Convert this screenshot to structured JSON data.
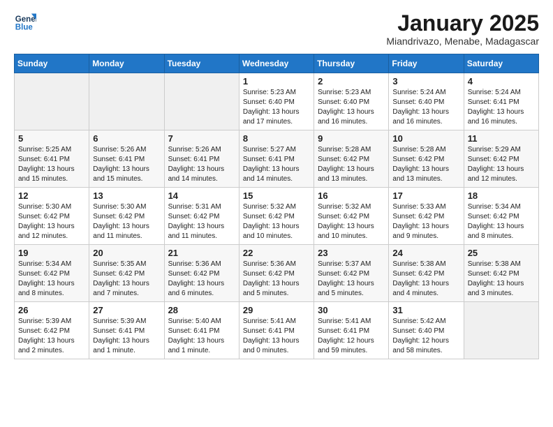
{
  "logo": {
    "line1": "General",
    "line2": "Blue"
  },
  "title": "January 2025",
  "subtitle": "Miandrivazo, Menabe, Madagascar",
  "weekdays": [
    "Sunday",
    "Monday",
    "Tuesday",
    "Wednesday",
    "Thursday",
    "Friday",
    "Saturday"
  ],
  "weeks": [
    [
      {
        "day": "",
        "content": ""
      },
      {
        "day": "",
        "content": ""
      },
      {
        "day": "",
        "content": ""
      },
      {
        "day": "1",
        "content": "Sunrise: 5:23 AM\nSunset: 6:40 PM\nDaylight: 13 hours\nand 17 minutes."
      },
      {
        "day": "2",
        "content": "Sunrise: 5:23 AM\nSunset: 6:40 PM\nDaylight: 13 hours\nand 16 minutes."
      },
      {
        "day": "3",
        "content": "Sunrise: 5:24 AM\nSunset: 6:40 PM\nDaylight: 13 hours\nand 16 minutes."
      },
      {
        "day": "4",
        "content": "Sunrise: 5:24 AM\nSunset: 6:41 PM\nDaylight: 13 hours\nand 16 minutes."
      }
    ],
    [
      {
        "day": "5",
        "content": "Sunrise: 5:25 AM\nSunset: 6:41 PM\nDaylight: 13 hours\nand 15 minutes."
      },
      {
        "day": "6",
        "content": "Sunrise: 5:26 AM\nSunset: 6:41 PM\nDaylight: 13 hours\nand 15 minutes."
      },
      {
        "day": "7",
        "content": "Sunrise: 5:26 AM\nSunset: 6:41 PM\nDaylight: 13 hours\nand 14 minutes."
      },
      {
        "day": "8",
        "content": "Sunrise: 5:27 AM\nSunset: 6:41 PM\nDaylight: 13 hours\nand 14 minutes."
      },
      {
        "day": "9",
        "content": "Sunrise: 5:28 AM\nSunset: 6:42 PM\nDaylight: 13 hours\nand 13 minutes."
      },
      {
        "day": "10",
        "content": "Sunrise: 5:28 AM\nSunset: 6:42 PM\nDaylight: 13 hours\nand 13 minutes."
      },
      {
        "day": "11",
        "content": "Sunrise: 5:29 AM\nSunset: 6:42 PM\nDaylight: 13 hours\nand 12 minutes."
      }
    ],
    [
      {
        "day": "12",
        "content": "Sunrise: 5:30 AM\nSunset: 6:42 PM\nDaylight: 13 hours\nand 12 minutes."
      },
      {
        "day": "13",
        "content": "Sunrise: 5:30 AM\nSunset: 6:42 PM\nDaylight: 13 hours\nand 11 minutes."
      },
      {
        "day": "14",
        "content": "Sunrise: 5:31 AM\nSunset: 6:42 PM\nDaylight: 13 hours\nand 11 minutes."
      },
      {
        "day": "15",
        "content": "Sunrise: 5:32 AM\nSunset: 6:42 PM\nDaylight: 13 hours\nand 10 minutes."
      },
      {
        "day": "16",
        "content": "Sunrise: 5:32 AM\nSunset: 6:42 PM\nDaylight: 13 hours\nand 10 minutes."
      },
      {
        "day": "17",
        "content": "Sunrise: 5:33 AM\nSunset: 6:42 PM\nDaylight: 13 hours\nand 9 minutes."
      },
      {
        "day": "18",
        "content": "Sunrise: 5:34 AM\nSunset: 6:42 PM\nDaylight: 13 hours\nand 8 minutes."
      }
    ],
    [
      {
        "day": "19",
        "content": "Sunrise: 5:34 AM\nSunset: 6:42 PM\nDaylight: 13 hours\nand 8 minutes."
      },
      {
        "day": "20",
        "content": "Sunrise: 5:35 AM\nSunset: 6:42 PM\nDaylight: 13 hours\nand 7 minutes."
      },
      {
        "day": "21",
        "content": "Sunrise: 5:36 AM\nSunset: 6:42 PM\nDaylight: 13 hours\nand 6 minutes."
      },
      {
        "day": "22",
        "content": "Sunrise: 5:36 AM\nSunset: 6:42 PM\nDaylight: 13 hours\nand 5 minutes."
      },
      {
        "day": "23",
        "content": "Sunrise: 5:37 AM\nSunset: 6:42 PM\nDaylight: 13 hours\nand 5 minutes."
      },
      {
        "day": "24",
        "content": "Sunrise: 5:38 AM\nSunset: 6:42 PM\nDaylight: 13 hours\nand 4 minutes."
      },
      {
        "day": "25",
        "content": "Sunrise: 5:38 AM\nSunset: 6:42 PM\nDaylight: 13 hours\nand 3 minutes."
      }
    ],
    [
      {
        "day": "26",
        "content": "Sunrise: 5:39 AM\nSunset: 6:42 PM\nDaylight: 13 hours\nand 2 minutes."
      },
      {
        "day": "27",
        "content": "Sunrise: 5:39 AM\nSunset: 6:41 PM\nDaylight: 13 hours\nand 1 minute."
      },
      {
        "day": "28",
        "content": "Sunrise: 5:40 AM\nSunset: 6:41 PM\nDaylight: 13 hours\nand 1 minute."
      },
      {
        "day": "29",
        "content": "Sunrise: 5:41 AM\nSunset: 6:41 PM\nDaylight: 13 hours\nand 0 minutes."
      },
      {
        "day": "30",
        "content": "Sunrise: 5:41 AM\nSunset: 6:41 PM\nDaylight: 12 hours\nand 59 minutes."
      },
      {
        "day": "31",
        "content": "Sunrise: 5:42 AM\nSunset: 6:40 PM\nDaylight: 12 hours\nand 58 minutes."
      },
      {
        "day": "",
        "content": ""
      }
    ]
  ]
}
